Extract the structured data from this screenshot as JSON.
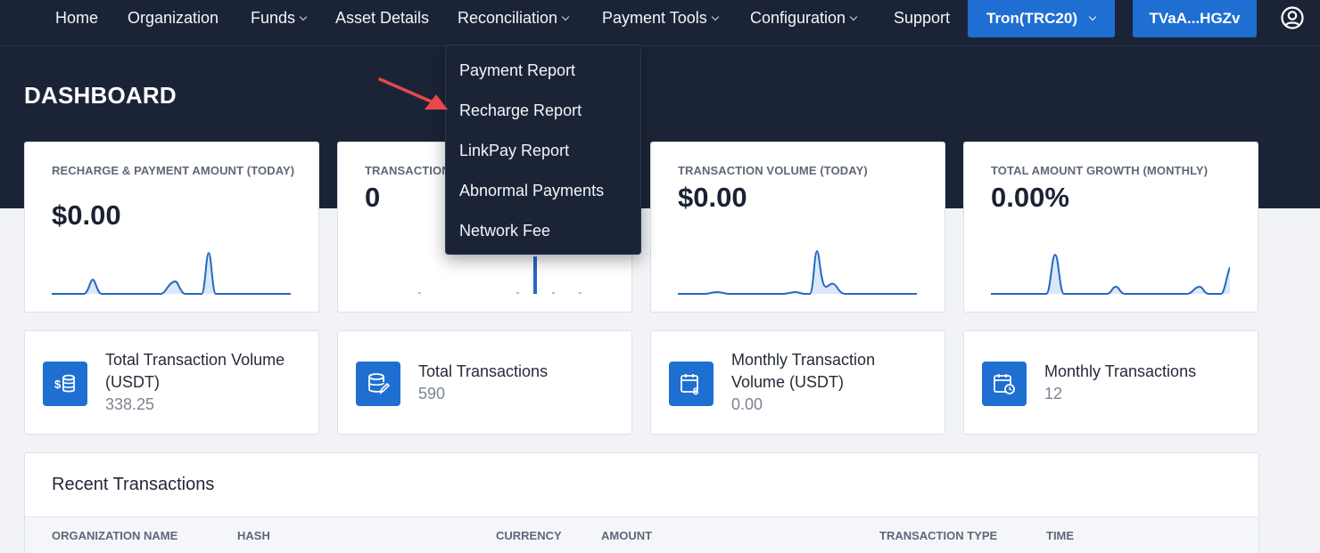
{
  "nav": {
    "items": [
      {
        "label": "Home"
      },
      {
        "label": "Organization"
      },
      {
        "label": "Funds"
      },
      {
        "label": "Asset Details"
      },
      {
        "label": "Reconciliation"
      },
      {
        "label": "Payment Tools"
      },
      {
        "label": "Configuration"
      },
      {
        "label": "Support"
      }
    ],
    "network_select": "Tron(TRC20)",
    "wallet": "TVaA...HGZv",
    "user_icon": "user-circle-icon"
  },
  "page_title": "DASHBOARD",
  "stats": [
    {
      "label": "RECHARGE & PAYMENT AMOUNT (TODAY)",
      "value": "$0.00"
    },
    {
      "label": "TRANSACTIONS",
      "value": "0"
    },
    {
      "label": "TRANSACTION VOLUME (TODAY)",
      "value": "$0.00"
    },
    {
      "label": "TOTAL AMOUNT GROWTH (MONTHLY)",
      "value": "0.00%"
    }
  ],
  "info_cards": [
    {
      "label": "Total Transaction Volume (USDT)",
      "value": "338.25",
      "icon": "dollar-coins-icon"
    },
    {
      "label": "Total Transactions",
      "value": "590",
      "icon": "database-edit-icon"
    },
    {
      "label": "Monthly Transaction Volume (USDT)",
      "value": "0.00",
      "icon": "calendar-dollar-icon"
    },
    {
      "label": "Monthly Transactions",
      "value": "12",
      "icon": "calendar-clock-icon"
    }
  ],
  "recent_transactions": {
    "title": "Recent Transactions",
    "columns": [
      "ORGANIZATION NAME",
      "HASH",
      "CURRENCY",
      "AMOUNT",
      "TRANSACTION TYPE",
      "TIME"
    ]
  },
  "reconciliation_menu": {
    "items": [
      "Payment Report",
      "Recharge Report",
      "LinkPay Report",
      "Abnormal Payments",
      "Network Fee"
    ]
  },
  "colors": {
    "topbar": "#1b2437",
    "accent": "#1f6fd2",
    "arrow": "#e8474e"
  }
}
